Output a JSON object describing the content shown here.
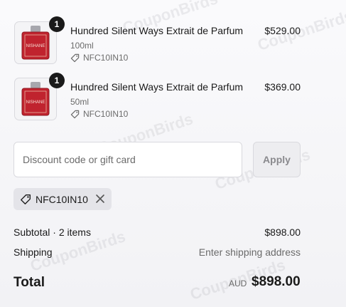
{
  "items": [
    {
      "name": "Hundred Silent Ways Extrait de Parfum",
      "variant": "100ml",
      "discount_code": "NFC10IN10",
      "price": "$529.00",
      "quantity": "1",
      "bottle_label": "NISHANE"
    },
    {
      "name": "Hundred Silent Ways Extrait de Parfum",
      "variant": "50ml",
      "discount_code": "NFC10IN10",
      "price": "$369.00",
      "quantity": "1",
      "bottle_label": "NISHANE"
    }
  ],
  "discount": {
    "placeholder": "Discount code or gift card",
    "value": "",
    "apply_label": "Apply"
  },
  "applied_code": {
    "label": "NFC10IN10"
  },
  "summary": {
    "subtotal_label": "Subtotal · 2 items",
    "subtotal_value": "$898.00",
    "shipping_label": "Shipping",
    "shipping_value": "Enter shipping address",
    "total_label": "Total",
    "currency": "AUD",
    "total_value": "$898.00"
  },
  "watermark": "CouponBirds",
  "icons": {
    "tag": "tag-icon",
    "remove": "close-icon"
  },
  "colors": {
    "bottle_red": "#c0232e",
    "badge": "#1a1a1a",
    "chip_bg": "#e4e4e9"
  }
}
